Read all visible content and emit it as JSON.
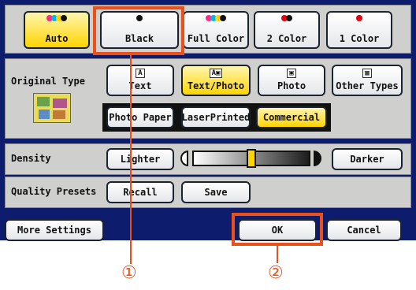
{
  "color_modes": [
    {
      "label": "Auto",
      "dots": [
        "#ff2a8a",
        "#00b7e6",
        "#ffd400",
        "#111111"
      ]
    },
    {
      "label": "Black",
      "dots": [
        "#111111"
      ]
    },
    {
      "label": "Full Color",
      "dots": [
        "#ff2a8a",
        "#00b7e6",
        "#ffd400",
        "#111111"
      ]
    },
    {
      "label": "2 Color",
      "dots": [
        "#e60012",
        "#111111"
      ]
    },
    {
      "label": "1 Color",
      "dots": [
        "#e60012"
      ]
    }
  ],
  "original_type": {
    "label": "Original Type",
    "types": [
      {
        "label": "Text",
        "icon": "A"
      },
      {
        "label": "Text/Photo",
        "icon": "A▣"
      },
      {
        "label": "Photo",
        "icon": "▣"
      },
      {
        "label": "Other Types",
        "icon": "▦"
      }
    ],
    "sub": [
      "Photo Paper",
      "LaserPrinted",
      "Commercial"
    ]
  },
  "density": {
    "label": "Density",
    "lighter": "Lighter",
    "darker": "Darker",
    "level_fraction": 0.5
  },
  "quality": {
    "label": "Quality Presets",
    "recall": "Recall",
    "save": "Save"
  },
  "footer": {
    "more": "More Settings",
    "ok": "OK",
    "cancel": "Cancel"
  },
  "callouts": {
    "one": "①",
    "two": "②",
    "accent": "#e8501c"
  }
}
